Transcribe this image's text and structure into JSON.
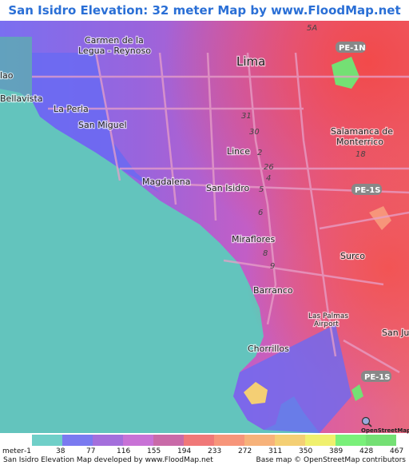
{
  "title": "San Isidro Elevation: 32 meter Map by www.FloodMap.net (beta)",
  "map": {
    "places": [
      {
        "id": "lima",
        "text": "Lima"
      },
      {
        "id": "carmen1",
        "text": "Carmen de la"
      },
      {
        "id": "carmen2",
        "text": "Legua - Reynoso"
      },
      {
        "id": "callao",
        "text": "lao"
      },
      {
        "id": "bellavista",
        "text": "Bellavista"
      },
      {
        "id": "laperla",
        "text": "La Perla"
      },
      {
        "id": "sanmiguel",
        "text": "San Miguel"
      },
      {
        "id": "magdalena",
        "text": "Magdalena"
      },
      {
        "id": "lince",
        "text": "Lince"
      },
      {
        "id": "sanisidro",
        "text": "San Isidro"
      },
      {
        "id": "salamanca1",
        "text": "Salamanca de"
      },
      {
        "id": "salamanca2",
        "text": "Monterrico"
      },
      {
        "id": "miraflores",
        "text": "Miraflores"
      },
      {
        "id": "surco",
        "text": "Surco"
      },
      {
        "id": "barranco",
        "text": "Barranco"
      },
      {
        "id": "laspalmas1",
        "text": "Las Palmas"
      },
      {
        "id": "laspalmas2",
        "text": "Airport"
      },
      {
        "id": "sanjuan",
        "text": "San Jua"
      },
      {
        "id": "chorrillos",
        "text": "Chorrillos"
      }
    ],
    "shields": [
      {
        "id": "pe1n",
        "text": "PE-1N"
      },
      {
        "id": "pe1s_a",
        "text": "PE-1S"
      },
      {
        "id": "pe1s_b",
        "text": "PE-1S"
      }
    ],
    "road_numbers": [
      "5A",
      "31",
      "30",
      "2",
      "26",
      "4",
      "5",
      "6",
      "8",
      "9",
      "18"
    ]
  },
  "legend": {
    "unit": "meter",
    "ticks": [
      "-1",
      "38",
      "77",
      "116",
      "155",
      "194",
      "233",
      "272",
      "311",
      "350",
      "389",
      "428",
      "467"
    ],
    "colors": [
      "#6fcfc8",
      "#7a7af0",
      "#a46fdc",
      "#c872d6",
      "#c96aa8",
      "#f07878",
      "#f7957a",
      "#f7b27a",
      "#f4cf74",
      "#f0f06e",
      "#7af07a",
      "#74e074"
    ]
  },
  "footer": {
    "left": "San Isidro Elevation Map developed by www.FloodMap.net",
    "right": "Base map © OpenStreetMap contributors"
  },
  "attribution_logo": "OpenStreetMap"
}
